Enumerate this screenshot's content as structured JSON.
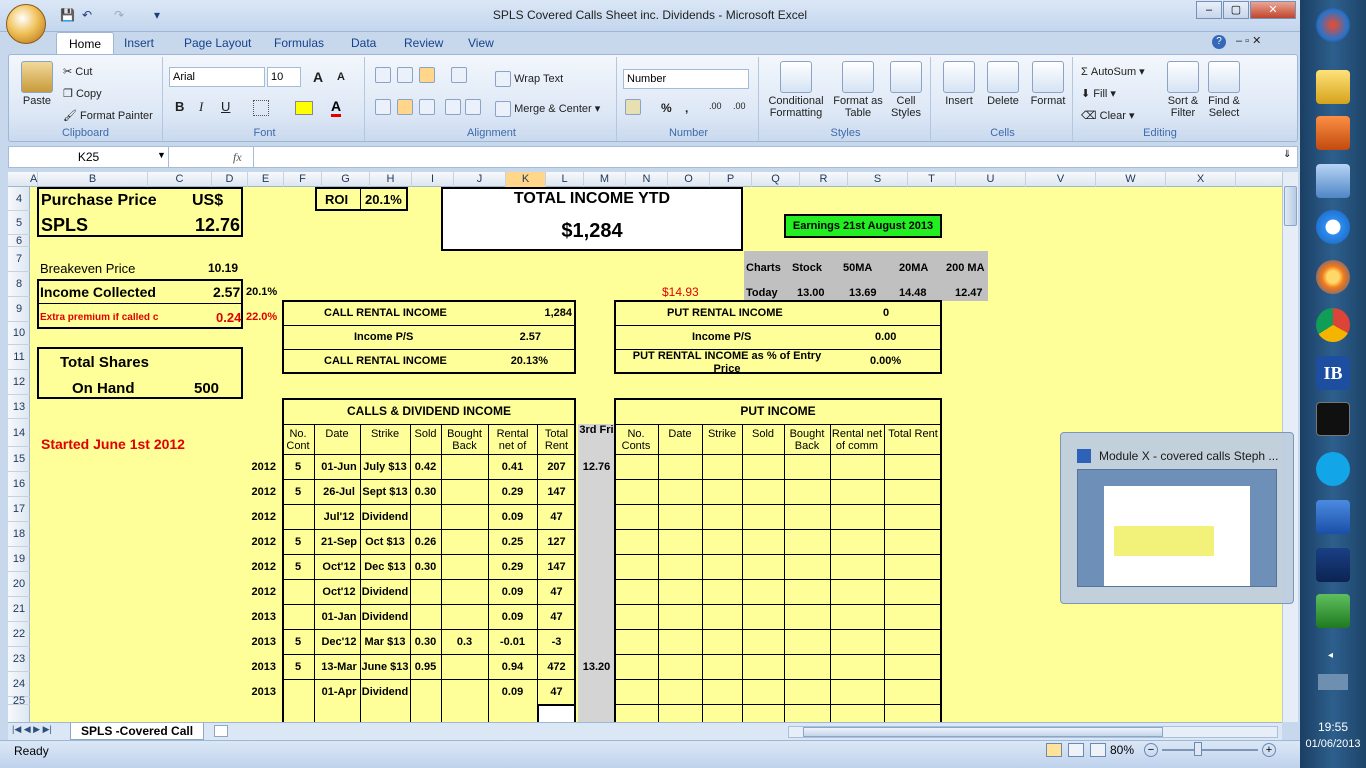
{
  "window": {
    "title": "SPLS Covered Calls Sheet inc. Dividends - Microsoft Excel",
    "controls": {
      "min": "‒",
      "max": "▢",
      "close": "✕"
    }
  },
  "tabs": [
    "Home",
    "Insert",
    "Page Layout",
    "Formulas",
    "Data",
    "Review",
    "View"
  ],
  "ribbon": {
    "clipboard": {
      "label": "Clipboard",
      "paste": "Paste",
      "cut": "Cut",
      "copy": "Copy",
      "format_painter": "Format Painter"
    },
    "font": {
      "label": "Font",
      "name": "Arial",
      "size": "10",
      "bold": "B",
      "italic": "I",
      "underline": "U",
      "grow": "A",
      "shrink": "A"
    },
    "alignment": {
      "label": "Alignment",
      "wrap": "Wrap Text",
      "merge": "Merge & Center"
    },
    "number": {
      "label": "Number",
      "format": "Number",
      "percent": "%",
      "comma": ",",
      "inc": ".00",
      "dec": ".00"
    },
    "styles": {
      "label": "Styles",
      "conditional": "Conditional Formatting",
      "format_table": "Format as Table",
      "cell_styles": "Cell Styles"
    },
    "cells": {
      "label": "Cells",
      "insert": "Insert",
      "delete": "Delete",
      "format": "Format"
    },
    "editing": {
      "label": "Editing",
      "autosum": "AutoSum",
      "fill": "Fill",
      "clear": "Clear",
      "sort": "Sort & Filter",
      "find": "Find & Select"
    }
  },
  "formula_bar": {
    "name_box": "K25",
    "fx": "fx",
    "value": ""
  },
  "columns": [
    "A",
    "B",
    "C",
    "D",
    "E",
    "F",
    "G",
    "H",
    "I",
    "J",
    "K",
    "L",
    "M",
    "N",
    "O",
    "P",
    "Q",
    "R",
    "S",
    "T",
    "U",
    "V",
    "W",
    "X"
  ],
  "rows": [
    "4",
    "5",
    "6",
    "7",
    "8",
    "9",
    "10",
    "11",
    "12",
    "13",
    "14",
    "15",
    "16",
    "17",
    "18",
    "19",
    "20",
    "21",
    "22",
    "23",
    "24",
    "25"
  ],
  "sheet": {
    "purchase_price_label": "Purchase Price",
    "currency": "US$",
    "ticker": "SPLS",
    "purchase_price": "12.76",
    "roi_label": "ROI",
    "roi": "20.1%",
    "total_income_label": "TOTAL INCOME YTD",
    "total_income": "$1,284",
    "earnings": "Earnings 21st August 2013",
    "breakeven_label": "Breakeven Price",
    "breakeven": "10.19",
    "income_collected_label": "Income Collected",
    "income_collected": "2.57",
    "income_collected_pct": "20.1%",
    "extra_premium_label": "Extra premium if called c",
    "extra_premium": "0.24",
    "extra_premium_pct": "22.0%",
    "total_shares_label": "Total Shares",
    "on_hand_label": "On Hand",
    "on_hand": "500",
    "started": "Started June 1st 2012",
    "put_price": "$14.93",
    "charts": {
      "headers": [
        "Charts",
        "Stock",
        "50MA",
        "20MA",
        "200 MA"
      ],
      "row": [
        "Today",
        "13.00",
        "13.69",
        "14.48",
        "12.47"
      ]
    },
    "call_summary": [
      {
        "label": "CALL RENTAL INCOME",
        "value": "1,284"
      },
      {
        "label": "Income P/S",
        "value": "2.57"
      },
      {
        "label": "CALL RENTAL INCOME",
        "value": "20.13%"
      }
    ],
    "put_summary": [
      {
        "label": "PUT RENTAL INCOME",
        "value": "0"
      },
      {
        "label": "Income P/S",
        "value": "0.00"
      },
      {
        "label": "PUT RENTAL INCOME as % of Entry Price",
        "value": "0.00%"
      }
    ],
    "calls_title": "CALLS & DIVIDEND INCOME",
    "put_title": "PUT INCOME",
    "third_fri": "3rd Fri",
    "calls_headers": [
      "No. Cont",
      "Date",
      "Strike",
      "Sold",
      "Bought Back",
      "Rental net of",
      "Total Rent"
    ],
    "put_headers": [
      "No. Conts",
      "Date",
      "Strike",
      "Sold",
      "Bought Back",
      "Rental net of comm",
      "Total Rent"
    ],
    "calls_rows": [
      {
        "year": "2012",
        "cont": "5",
        "date": "01-Jun",
        "strike": "July $13",
        "sold": "0.42",
        "bought": "",
        "net": "0.41",
        "total": "207",
        "fri": "12.76"
      },
      {
        "year": "2012",
        "cont": "5",
        "date": "26-Jul",
        "strike": "Sept $13",
        "sold": "0.30",
        "bought": "",
        "net": "0.29",
        "total": "147",
        "fri": ""
      },
      {
        "year": "2012",
        "cont": "",
        "date": "Jul'12",
        "strike": "Dividend",
        "sold": "",
        "bought": "",
        "net": "0.09",
        "total": "47",
        "fri": ""
      },
      {
        "year": "2012",
        "cont": "5",
        "date": "21-Sep",
        "strike": "Oct $13",
        "sold": "0.26",
        "bought": "",
        "net": "0.25",
        "total": "127",
        "fri": ""
      },
      {
        "year": "2012",
        "cont": "5",
        "date": "Oct'12",
        "strike": "Dec $13",
        "sold": "0.30",
        "bought": "",
        "net": "0.29",
        "total": "147",
        "fri": ""
      },
      {
        "year": "2012",
        "cont": "",
        "date": "Oct'12",
        "strike": "Dividend",
        "sold": "",
        "bought": "",
        "net": "0.09",
        "total": "47",
        "fri": ""
      },
      {
        "year": "2013",
        "cont": "",
        "date": "01-Jan",
        "strike": "Dividend",
        "sold": "",
        "bought": "",
        "net": "0.09",
        "total": "47",
        "fri": ""
      },
      {
        "year": "2013",
        "cont": "5",
        "date": "Dec'12",
        "strike": "Mar $13",
        "sold": "0.30",
        "bought": "0.3",
        "net": "-0.01",
        "total": "-3",
        "fri": ""
      },
      {
        "year": "2013",
        "cont": "5",
        "date": "13-Mar",
        "strike": "June $13",
        "sold": "0.95",
        "bought": "",
        "net": "0.94",
        "total": "472",
        "fri": "13.20"
      },
      {
        "year": "2013",
        "cont": "",
        "date": "01-Apr",
        "strike": "Dividend",
        "sold": "",
        "bought": "",
        "net": "0.09",
        "total": "47",
        "fri": ""
      }
    ]
  },
  "sheet_tab": "SPLS -Covered Call",
  "status": {
    "ready": "Ready",
    "zoom": "80%"
  },
  "taskbar": {
    "time": "19:55",
    "date": "01/06/2013",
    "ib": "IB",
    "popup_title": "Module X - covered calls Steph ..."
  }
}
